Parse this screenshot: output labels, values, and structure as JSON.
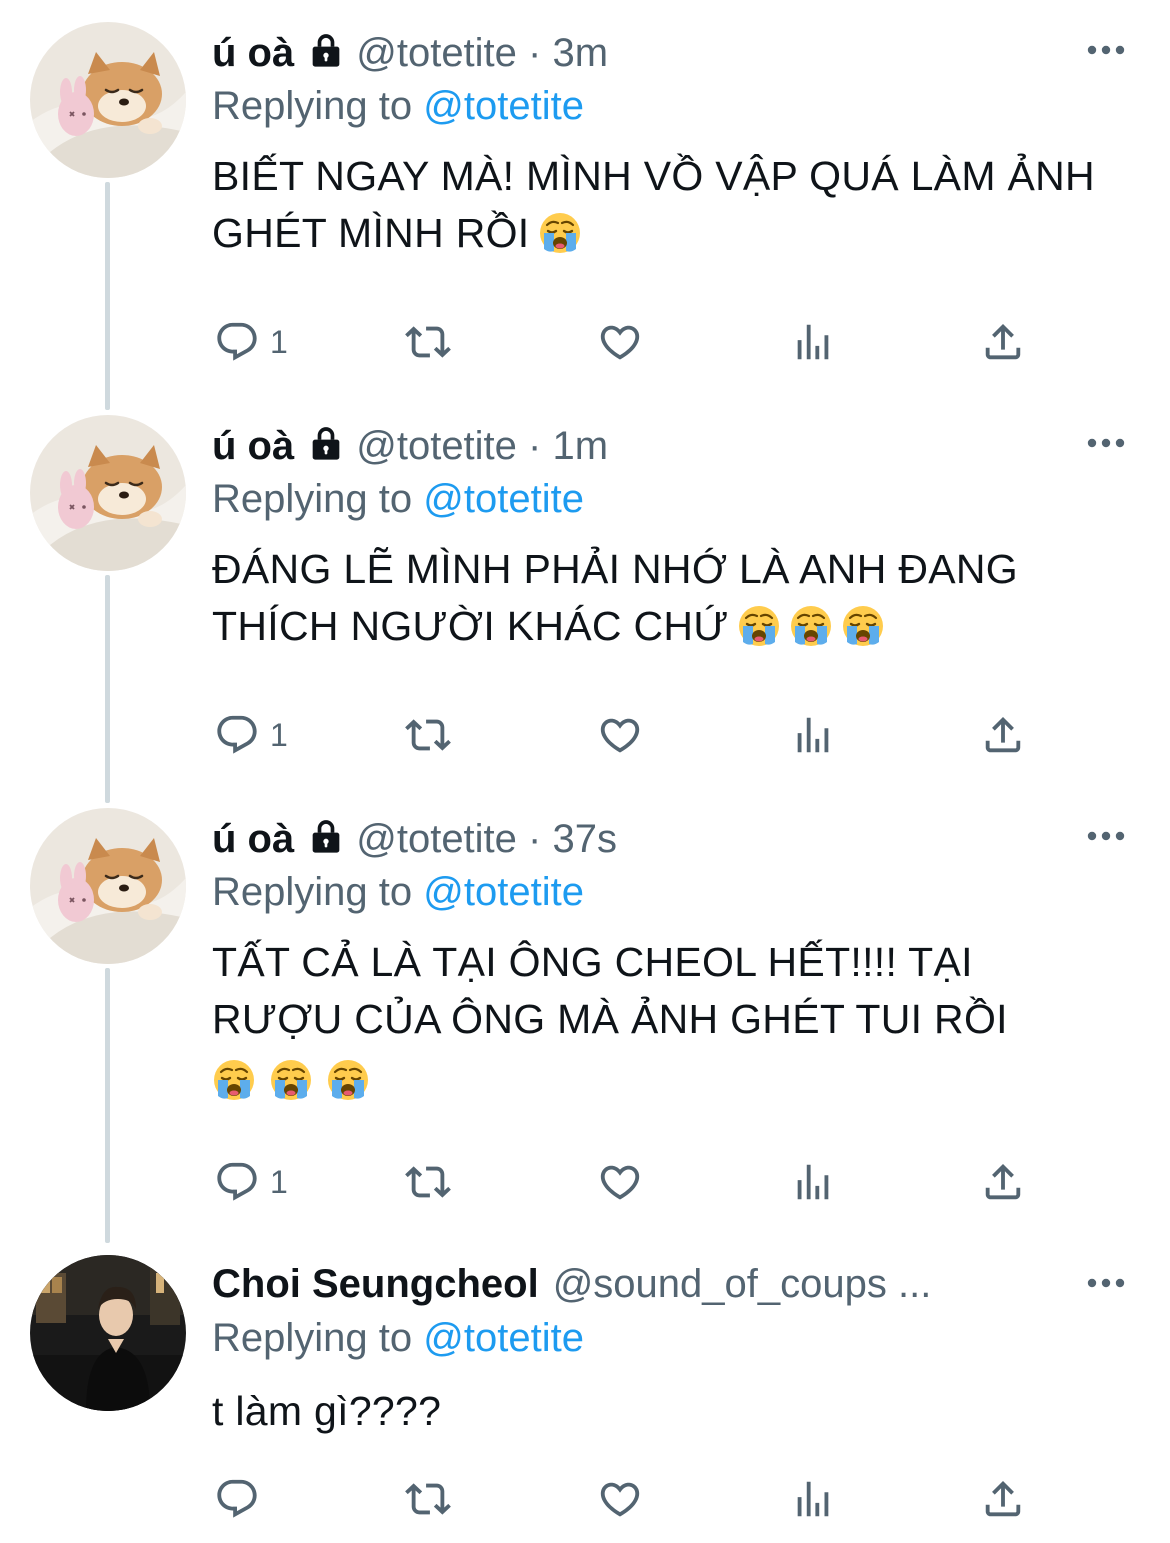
{
  "colors": {
    "link": "#1d9bf0",
    "secondary": "#536471",
    "primary": "#0f1419",
    "thread_line": "#cfd9de"
  },
  "icons": {
    "protected": "lock-icon",
    "more": "more-icon",
    "reply": "reply-icon",
    "retweet": "retweet-icon",
    "like": "like-icon",
    "views": "views-icon",
    "share": "share-icon",
    "emoji": "loudly-crying-face-emoji"
  },
  "tweets": [
    {
      "name": "ú oà",
      "handle": "@totetite",
      "time": "3m",
      "replying_label": "Replying to",
      "replying_to": "@totetite",
      "text": "BIẾT NGAY MÀ! MÌNH VỒ VẬP QUÁ LÀM ẢNH GHÉT MÌNH RỒI",
      "reply_count": "1"
    },
    {
      "name": "ú oà",
      "handle": "@totetite",
      "time": "1m",
      "replying_label": "Replying to",
      "replying_to": "@totetite",
      "text": "ĐÁNG LẼ MÌNH PHẢI NHỚ LÀ ANH ĐANG THÍCH NGƯỜI KHÁC CHỨ",
      "reply_count": "1"
    },
    {
      "name": "ú oà",
      "handle": "@totetite",
      "time": "37s",
      "replying_label": "Replying to",
      "replying_to": "@totetite",
      "text_line1": "TẤT CẢ LÀ TẠI ÔNG CHEOL HẾT!!!! TẠI",
      "text_line2": "RƯỢU CỦA ÔNG MÀ ẢNH GHÉT TUI RỒI",
      "reply_count": "1"
    },
    {
      "name": "Choi Seungcheol",
      "handle": "@sound_of_coups ...",
      "replying_label": "Replying to",
      "replying_to": "@totetite",
      "text": "t làm gì????",
      "reply_count": ""
    }
  ]
}
